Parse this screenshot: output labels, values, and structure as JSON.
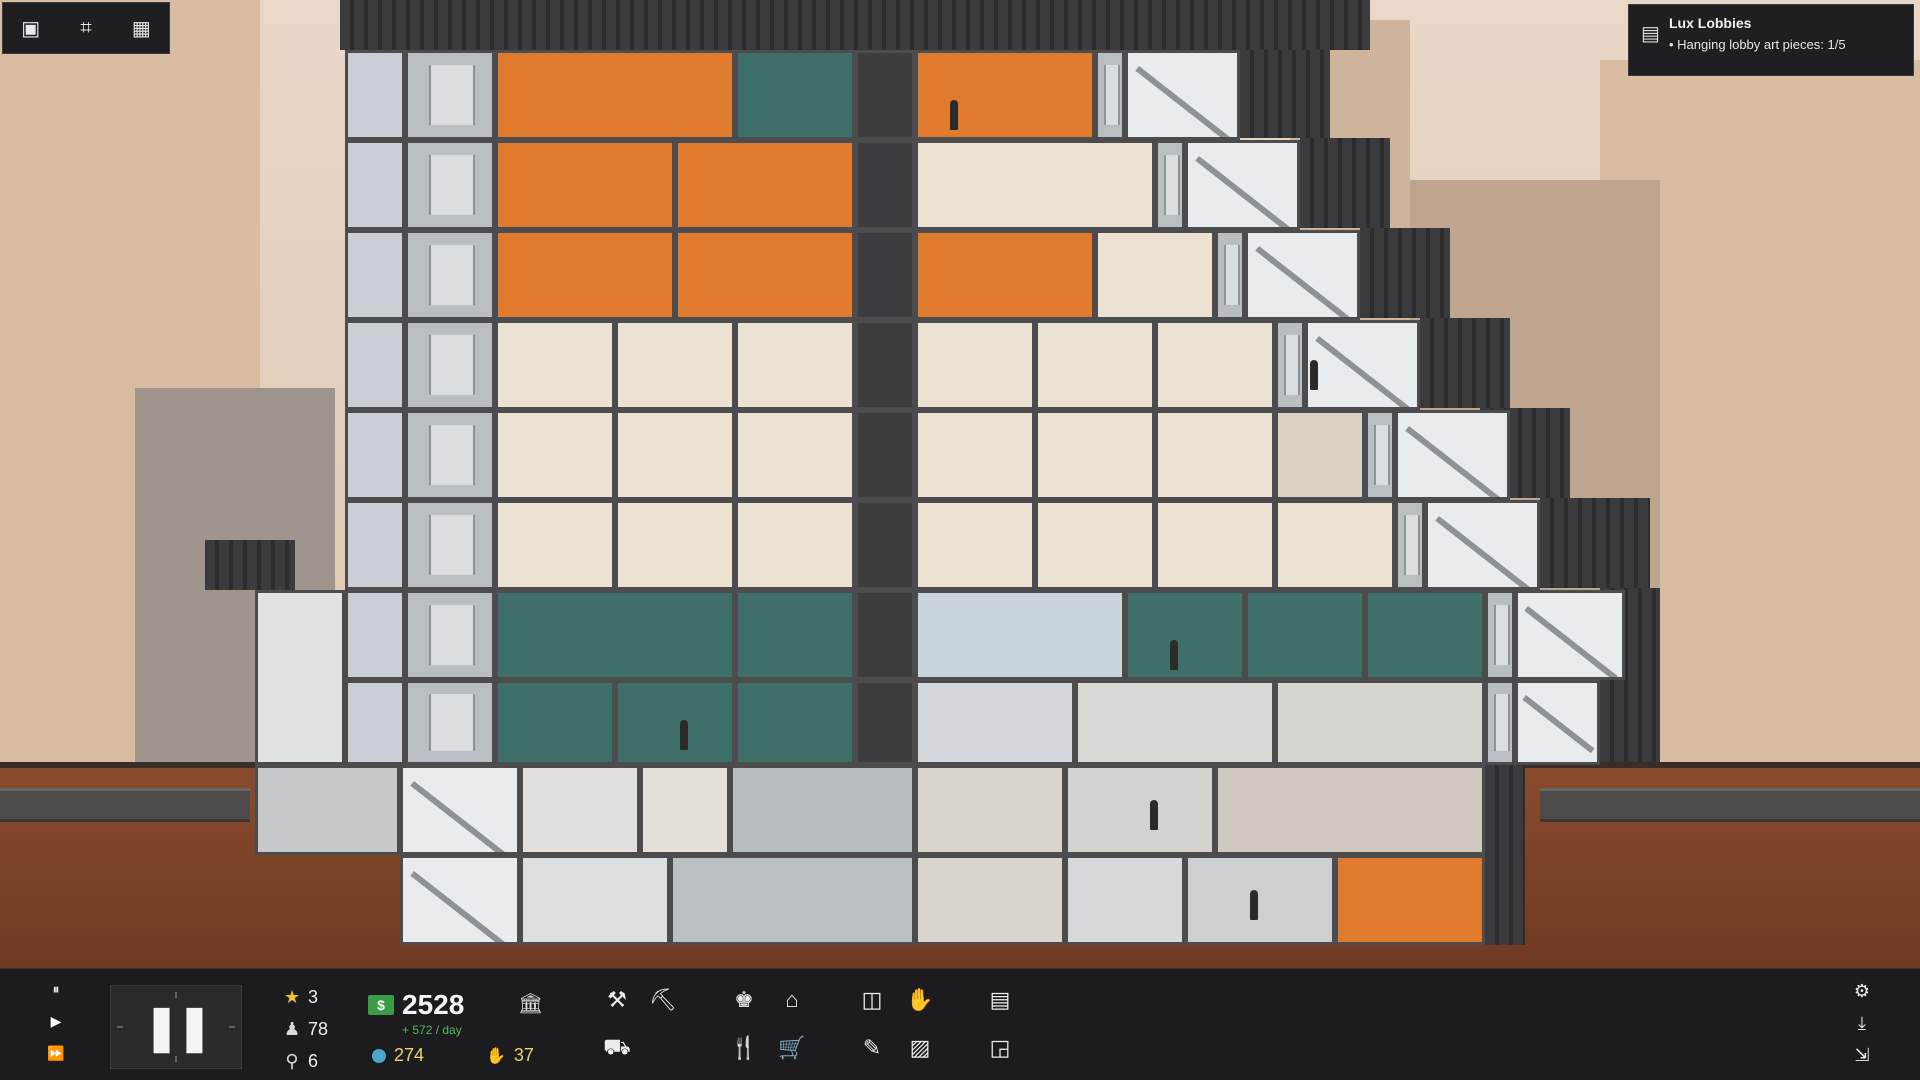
{
  "hud": {
    "speed_buttons": [
      "⏸",
      "▶",
      "⏩"
    ],
    "clock_icon": "pause-icon",
    "rating": "3",
    "population": "78",
    "residents": "6",
    "money": "2528",
    "money_rate": "+ 572 / day",
    "eco_points": "274",
    "influence": "37",
    "settings_icon": "gear-icon",
    "save_icon": "download-icon",
    "exit_icon": "exit-icon"
  },
  "objective": {
    "title": "Lux Lobbies",
    "items": [
      "• Hanging lobby art pieces: 1/5"
    ]
  },
  "colors": {
    "accent": "#f2b23a",
    "money_green": "#3b9b46",
    "influence": "#8a6ce0",
    "eco": "#4ea7c8"
  }
}
